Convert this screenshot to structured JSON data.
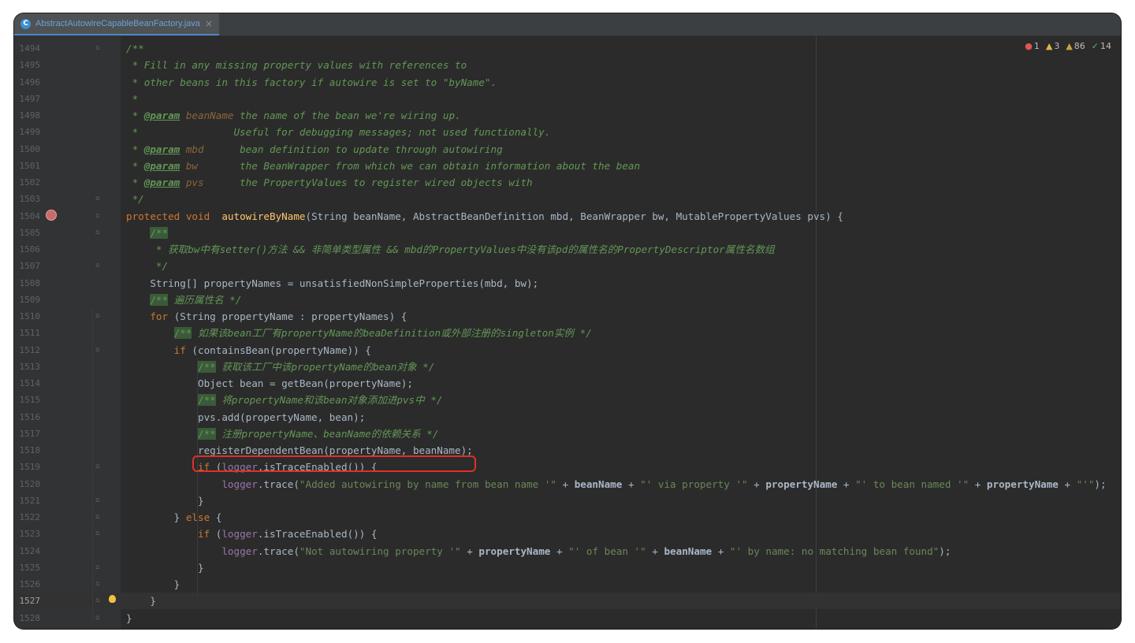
{
  "tab": {
    "label": "AbstractAutowireCapableBeanFactory.java",
    "icon": "class-file-icon"
  },
  "status": {
    "errors": "1",
    "warnings": "3",
    "weak_warnings": "86",
    "ok_count": "14"
  },
  "lines": [
    {
      "n": "1494",
      "segs": [
        [
          "doc",
          "/**"
        ]
      ]
    },
    {
      "n": "1495",
      "segs": [
        [
          "doc",
          " * Fill in any missing property values with references to"
        ]
      ]
    },
    {
      "n": "1496",
      "segs": [
        [
          "doc",
          " * other beans in this factory if autowire is set to \"byName\"."
        ]
      ]
    },
    {
      "n": "1497",
      "segs": [
        [
          "doc",
          " *"
        ]
      ]
    },
    {
      "n": "1498",
      "segs": [
        [
          "doc",
          " * "
        ],
        [
          "tag",
          "@param"
        ],
        [
          "pn",
          " beanName"
        ],
        [
          "doc",
          " the name of the bean we're wiring up."
        ]
      ]
    },
    {
      "n": "1499",
      "segs": [
        [
          "doc",
          " *                Useful for debugging messages; not used functionally."
        ]
      ]
    },
    {
      "n": "1500",
      "segs": [
        [
          "doc",
          " * "
        ],
        [
          "tag",
          "@param"
        ],
        [
          "pn",
          " mbd"
        ],
        [
          "doc",
          "      bean definition to update through autowiring"
        ]
      ]
    },
    {
      "n": "1501",
      "segs": [
        [
          "doc",
          " * "
        ],
        [
          "tag",
          "@param"
        ],
        [
          "pn",
          " bw"
        ],
        [
          "doc",
          "       the BeanWrapper from which we can obtain information about the bean"
        ]
      ]
    },
    {
      "n": "1502",
      "segs": [
        [
          "doc",
          " * "
        ],
        [
          "tag",
          "@param"
        ],
        [
          "pn",
          " pvs"
        ],
        [
          "doc",
          "      the PropertyValues to register wired objects with"
        ]
      ]
    },
    {
      "n": "1503",
      "segs": [
        [
          "doc",
          " */"
        ]
      ]
    },
    {
      "n": "1504",
      "segs": [
        [
          "kw",
          "protected void  "
        ],
        [
          "fn",
          "autowireByName"
        ],
        [
          "",
          "(String beanName, AbstractBeanDefinition mbd, BeanWrapper bw, MutablePropertyValues pvs) {"
        ]
      ]
    },
    {
      "n": "1505",
      "segs": [
        [
          "",
          "    "
        ],
        [
          "hl",
          "/**"
        ]
      ]
    },
    {
      "n": "1506",
      "segs": [
        [
          "doc",
          "     * 获取bw中有setter()方法 && 非简单类型属性 && mbd的PropertyValues中没有该pd的属性名的PropertyDescriptor属性名数组"
        ]
      ]
    },
    {
      "n": "1507",
      "segs": [
        [
          "doc",
          "     */"
        ]
      ]
    },
    {
      "n": "1508",
      "segs": [
        [
          "",
          "    String[] propertyNames = unsatisfiedNonSimpleProperties(mbd, bw);"
        ]
      ]
    },
    {
      "n": "1509",
      "segs": [
        [
          "",
          "    "
        ],
        [
          "hl",
          "/**"
        ],
        [
          "doc",
          " 遍历属性名 */"
        ]
      ]
    },
    {
      "n": "1510",
      "segs": [
        [
          "",
          "    "
        ],
        [
          "kw",
          "for "
        ],
        [
          "",
          "(String propertyName : propertyNames) {"
        ]
      ]
    },
    {
      "n": "1511",
      "segs": [
        [
          "",
          "        "
        ],
        [
          "hl",
          "/**"
        ],
        [
          "doc",
          " 如果该bean工厂有propertyName的beaDefinition或外部注册的singleton实例 */"
        ]
      ]
    },
    {
      "n": "1512",
      "segs": [
        [
          "",
          "        "
        ],
        [
          "kw",
          "if "
        ],
        [
          "",
          "(containsBean(propertyName)) {"
        ]
      ]
    },
    {
      "n": "1513",
      "segs": [
        [
          "",
          "            "
        ],
        [
          "hl",
          "/**"
        ],
        [
          "doc",
          " 获取该工厂中该propertyName的bean对象 */"
        ]
      ]
    },
    {
      "n": "1514",
      "segs": [
        [
          "",
          "            Object bean = getBean(propertyName);"
        ]
      ]
    },
    {
      "n": "1515",
      "segs": [
        [
          "",
          "            "
        ],
        [
          "hl",
          "/**"
        ],
        [
          "doc",
          " 将propertyName和该bean对象添加进pvs中 */"
        ]
      ]
    },
    {
      "n": "1516",
      "segs": [
        [
          "",
          "            pvs.add(propertyName, bean);"
        ]
      ]
    },
    {
      "n": "1517",
      "segs": [
        [
          "",
          "            "
        ],
        [
          "hl",
          "/**"
        ],
        [
          "doc",
          " 注册propertyName、beanName的依赖关系 */"
        ]
      ]
    },
    {
      "n": "1518",
      "segs": [
        [
          "",
          "            registerDependentBean(propertyName, beanName);"
        ]
      ]
    },
    {
      "n": "1519",
      "segs": [
        [
          "",
          "            "
        ],
        [
          "kw",
          "if "
        ],
        [
          "",
          "("
        ],
        [
          "fld",
          "logger"
        ],
        [
          "",
          ".isTraceEnabled()) {"
        ]
      ]
    },
    {
      "n": "1520",
      "segs": [
        [
          "",
          "                "
        ],
        [
          "fld",
          "logger"
        ],
        [
          "",
          ".trace("
        ],
        [
          "str",
          "\"Added autowiring by name from bean name '\""
        ],
        [
          "",
          " + "
        ],
        [
          "bold",
          "beanName"
        ],
        [
          "",
          " + "
        ],
        [
          "str",
          "\"' via property '\""
        ],
        [
          "",
          " + "
        ],
        [
          "bold",
          "propertyName"
        ],
        [
          "",
          " + "
        ],
        [
          "str",
          "\"' to bean named '\""
        ],
        [
          "",
          " + "
        ],
        [
          "bold",
          "propertyName"
        ],
        [
          "",
          " + "
        ],
        [
          "str",
          "\"'\""
        ],
        [
          "",
          ");"
        ]
      ]
    },
    {
      "n": "1521",
      "segs": [
        [
          "",
          "            }"
        ]
      ]
    },
    {
      "n": "1522",
      "segs": [
        [
          "",
          "        } "
        ],
        [
          "kw",
          "else "
        ],
        [
          "",
          "{"
        ]
      ]
    },
    {
      "n": "1523",
      "segs": [
        [
          "",
          "            "
        ],
        [
          "kw",
          "if "
        ],
        [
          "",
          "("
        ],
        [
          "fld",
          "logger"
        ],
        [
          "",
          ".isTraceEnabled()) {"
        ]
      ]
    },
    {
      "n": "1524",
      "segs": [
        [
          "",
          "                "
        ],
        [
          "fld",
          "logger"
        ],
        [
          "",
          ".trace("
        ],
        [
          "str",
          "\"Not autowiring property '\""
        ],
        [
          "",
          " + "
        ],
        [
          "bold",
          "propertyName"
        ],
        [
          "",
          " + "
        ],
        [
          "str",
          "\"' of bean '\""
        ],
        [
          "",
          " + "
        ],
        [
          "bold",
          "beanName"
        ],
        [
          "",
          " + "
        ],
        [
          "str",
          "\"' by name: no matching bean found\""
        ],
        [
          "",
          ");"
        ]
      ]
    },
    {
      "n": "1525",
      "segs": [
        [
          "",
          "            }"
        ]
      ]
    },
    {
      "n": "1526",
      "segs": [
        [
          "",
          "        }"
        ]
      ]
    },
    {
      "n": "1527",
      "segs": [
        [
          "",
          "    }"
        ]
      ],
      "current": true
    },
    {
      "n": "1528",
      "segs": [
        [
          "",
          "}"
        ]
      ]
    }
  ]
}
